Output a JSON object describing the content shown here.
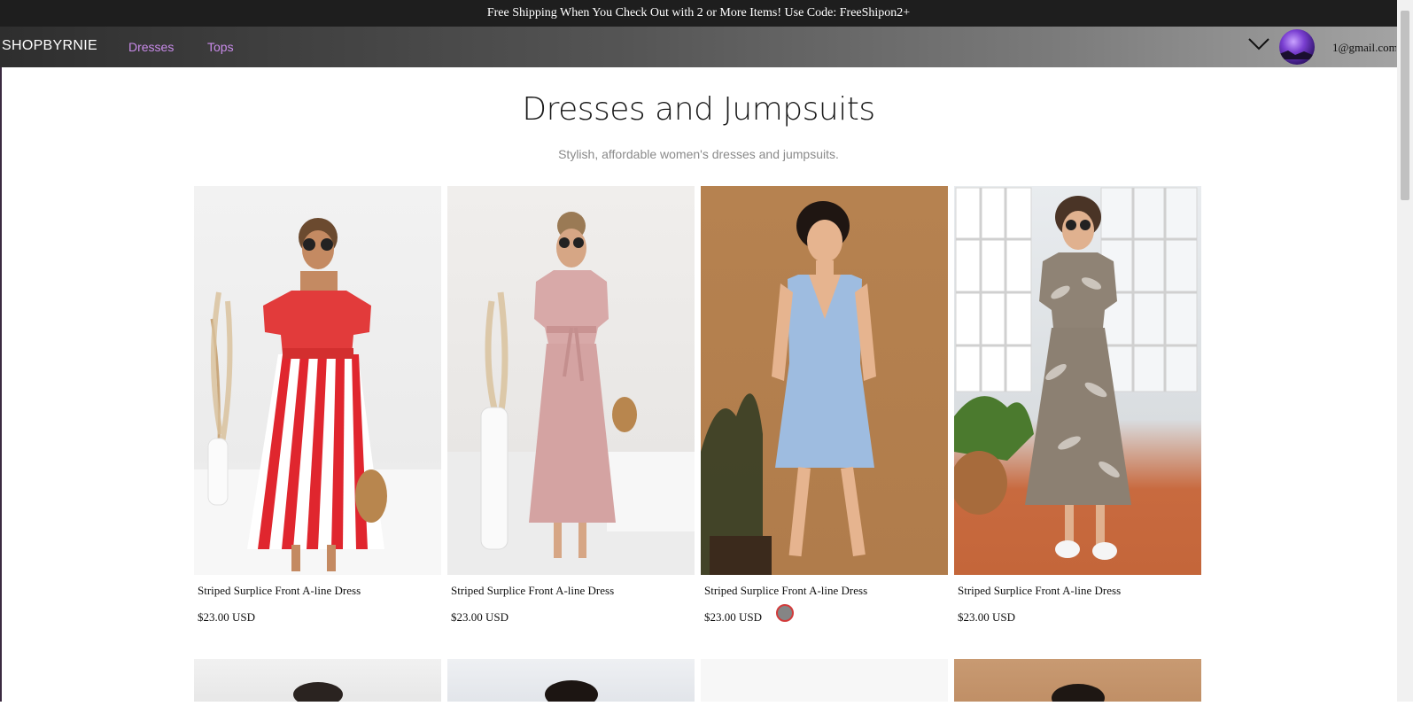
{
  "promo": {
    "text": "Free Shipping When You Check Out with 2 or More Items! Use Code: FreeShipon2+"
  },
  "nav": {
    "brand": "SHOPBYRNIE",
    "links": [
      {
        "label": "Dresses"
      },
      {
        "label": "Tops"
      }
    ],
    "user_email": "1@gmail.com",
    "link_color": "#c98bea"
  },
  "header": {
    "title": "Dresses and Jumpsuits",
    "subtitle": "Stylish, affordable women's dresses and jumpsuits."
  },
  "products": [
    {
      "name": "Striped Surplice Front A-line Dress",
      "price": "$23.00 USD"
    },
    {
      "name": "Striped Surplice Front A-line Dress",
      "price": "$23.00 USD"
    },
    {
      "name": "Striped Surplice Front A-line Dress",
      "price": "$23.00 USD",
      "swatch_color": "#858585"
    },
    {
      "name": "Striped Surplice Front A-line Dress",
      "price": "$23.00 USD"
    }
  ],
  "icons": {
    "menu_toggle": "chevron-down-icon",
    "user": "avatar"
  }
}
